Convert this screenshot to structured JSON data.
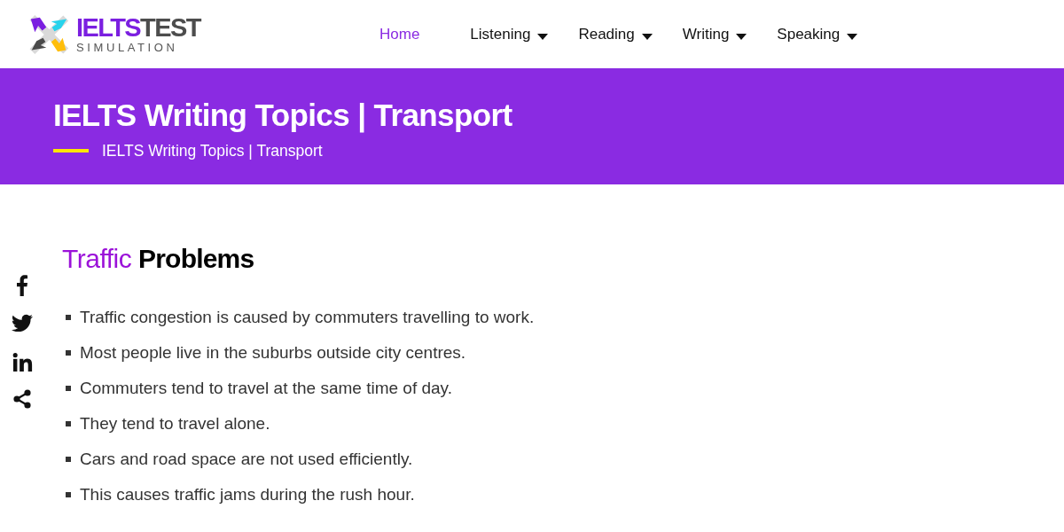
{
  "logo": {
    "brand_accent": "IELTS",
    "brand_rest": "TEST",
    "tagline": "SIMULATION"
  },
  "nav": [
    {
      "label": "Home",
      "selected": true,
      "has_menu": false
    },
    {
      "label": "Listening",
      "selected": false,
      "has_menu": true
    },
    {
      "label": "Reading",
      "selected": false,
      "has_menu": true
    },
    {
      "label": "Writing",
      "selected": false,
      "has_menu": true
    },
    {
      "label": "Speaking",
      "selected": false,
      "has_menu": true
    }
  ],
  "banner": {
    "title": "IELTS Writing Topics | Transport",
    "breadcrumb": "IELTS Writing Topics | Transport"
  },
  "section": {
    "heading_accent": "Traffic",
    "heading_rest": "Problems",
    "points": [
      "Traffic congestion is caused by commuters travelling to work.",
      "Most people live in the suburbs outside city centres.",
      "Commuters tend to travel at the same time of day.",
      "They tend to travel alone.",
      "Cars and road space are not used efficiently.",
      "This causes traffic jams during the rush hour."
    ]
  }
}
